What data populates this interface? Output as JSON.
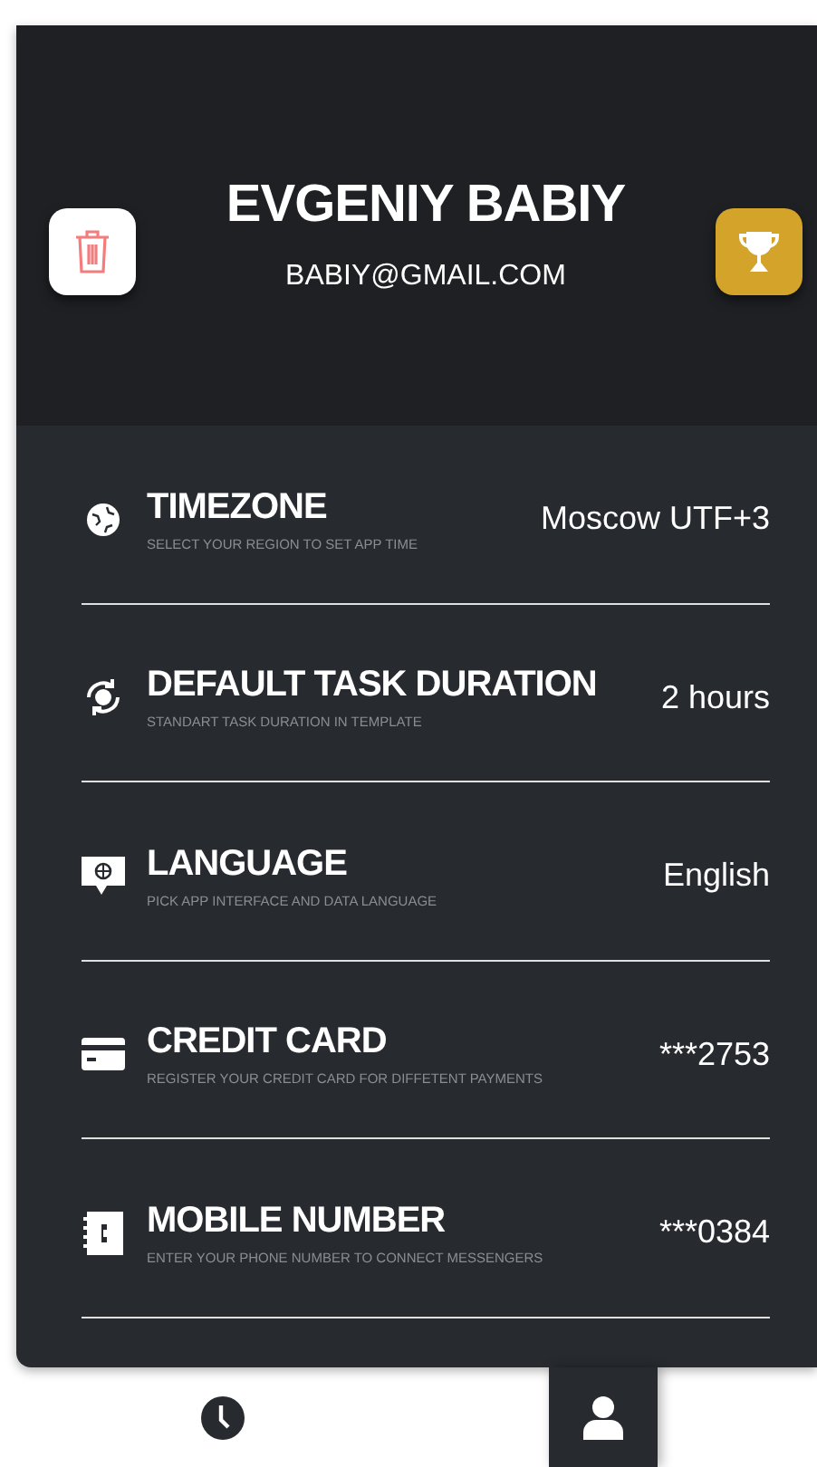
{
  "profile": {
    "name": "EVGENIY BABIY",
    "email": "BABIY@GMAIL.COM"
  },
  "header_buttons": [
    {
      "kind": "delete"
    },
    {
      "kind": "trophy"
    }
  ],
  "settings": [
    {
      "kind": "globe",
      "title": "TIMEZONE",
      "subtitle": "SELECT YOUR REGION TO SET APP TIME",
      "value": "Moscow UTF+3"
    },
    {
      "kind": "sync",
      "title": "DEFAULT TASK DURATION",
      "subtitle": "STANDART TASK DURATION IN TEMPLATE",
      "value": "2 hours"
    },
    {
      "kind": "language",
      "title": "LANGUAGE",
      "subtitle": "PICK APP INTERFACE AND DATA LANGUAGE",
      "value": "English"
    },
    {
      "kind": "card",
      "title": "CREDIT CARD",
      "subtitle": "REGISTER YOUR CREDIT CARD FOR DIFFETENT PAYMENTS",
      "value": "***2753"
    },
    {
      "kind": "phone",
      "title": "MOBILE NUMBER",
      "subtitle": "ENTER YOUR PHONE NUMBER TO CONNECT MESSENGERS",
      "value": "***0384"
    }
  ],
  "tabs": [
    {
      "kind": "clock",
      "selected": false
    },
    {
      "kind": "user",
      "selected": true
    }
  ]
}
